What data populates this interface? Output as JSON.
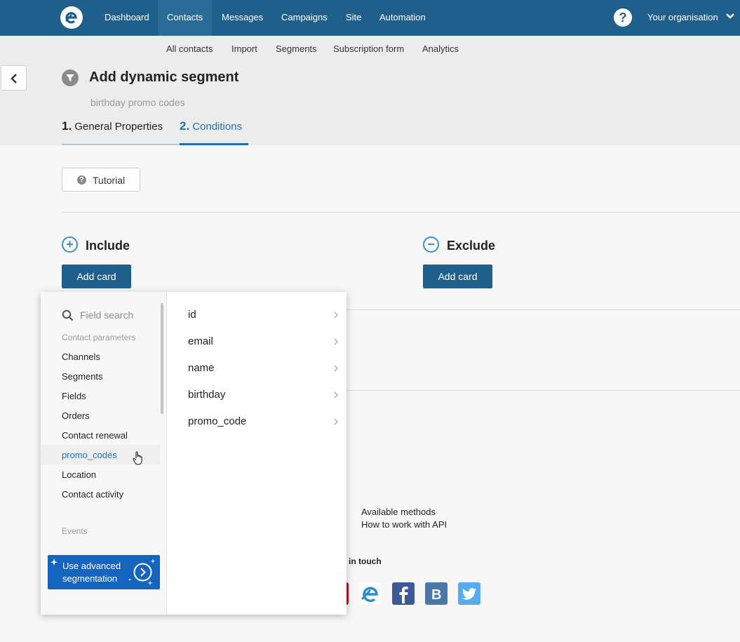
{
  "topnav": {
    "items": [
      "Dashboard",
      "Contacts",
      "Messages",
      "Campaigns",
      "Site",
      "Automation"
    ],
    "active": "Contacts",
    "help": "?",
    "org": "Your organisation"
  },
  "subnav": {
    "items": [
      "All contacts",
      "Import",
      "Segments",
      "Subscription form",
      "Analytics"
    ]
  },
  "header": {
    "title": "Add dynamic segment",
    "segment_name": "birthday promo codes",
    "steps": [
      {
        "num": "1.",
        "label": "General Properties"
      },
      {
        "num": "2.",
        "label": "Conditions"
      }
    ]
  },
  "main": {
    "tutorial": "Tutorial",
    "include_label": "Include",
    "exclude_label": "Exclude",
    "add_card": "Add card"
  },
  "dropdown": {
    "search_placeholder": "Field search",
    "group_contact": "Contact parameters",
    "categories": [
      "Channels",
      "Segments",
      "Fields",
      "Orders",
      "Contact renewal",
      "promo_codes",
      "Location",
      "Contact activity"
    ],
    "active_category": "promo_codes",
    "group_events": "Events",
    "advanced": "Use advanced segmentation",
    "fields": [
      "id",
      "email",
      "name",
      "birthday",
      "promo_code"
    ]
  },
  "footer": {
    "links": [
      "Available methods",
      "How to work with API"
    ],
    "get_in_touch": "in touch"
  },
  "colors": {
    "nav_bg": "#1f5f8b",
    "accent": "#1f6fb2",
    "advanced_bg": "#1565c0"
  }
}
